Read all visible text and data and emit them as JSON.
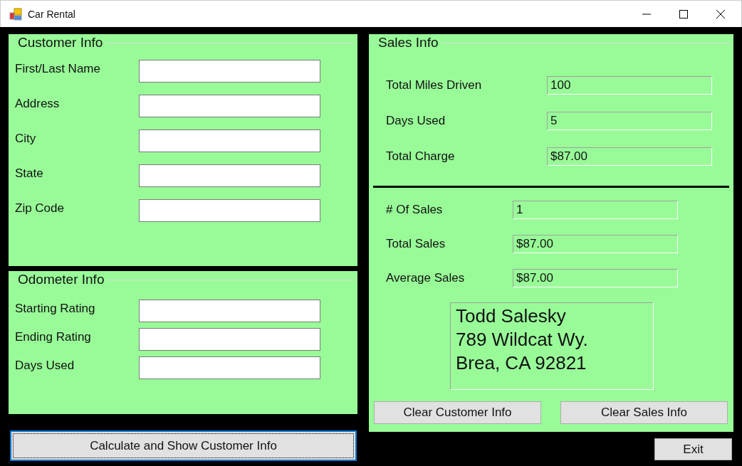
{
  "window": {
    "title": "Car Rental"
  },
  "customer_info": {
    "title": "Customer Info",
    "fields": [
      {
        "label": "First/Last Name"
      },
      {
        "label": "Address"
      },
      {
        "label": "City"
      },
      {
        "label": "State"
      },
      {
        "label": "Zip Code"
      }
    ]
  },
  "odometer_info": {
    "title": "Odometer Info",
    "fields": [
      {
        "label": "Starting Rating"
      },
      {
        "label": "Ending Rating"
      },
      {
        "label": "Days Used"
      }
    ]
  },
  "calculate_button": {
    "label": "Calculate and Show Customer Info",
    "focused": true
  },
  "sales_info": {
    "title": "Sales Info",
    "fields": [
      {
        "label": "Total Miles Driven",
        "value": "100"
      },
      {
        "label": "Days Used",
        "value": "5"
      },
      {
        "label": "Total Charge",
        "value": "$87.00"
      }
    ],
    "totals": [
      {
        "label": "# Of Sales",
        "value": "1"
      },
      {
        "label": "Total Sales",
        "value": "$87.00"
      },
      {
        "label": "Average Sales",
        "value": "$87.00"
      }
    ],
    "address_lines": [
      "Todd Salesky",
      "789 Wildcat Wy.",
      "Brea, CA 92821"
    ],
    "buttons": [
      "Clear Customer Info",
      "Clear Sales Info"
    ]
  },
  "exit_button": {
    "label": "Exit"
  }
}
